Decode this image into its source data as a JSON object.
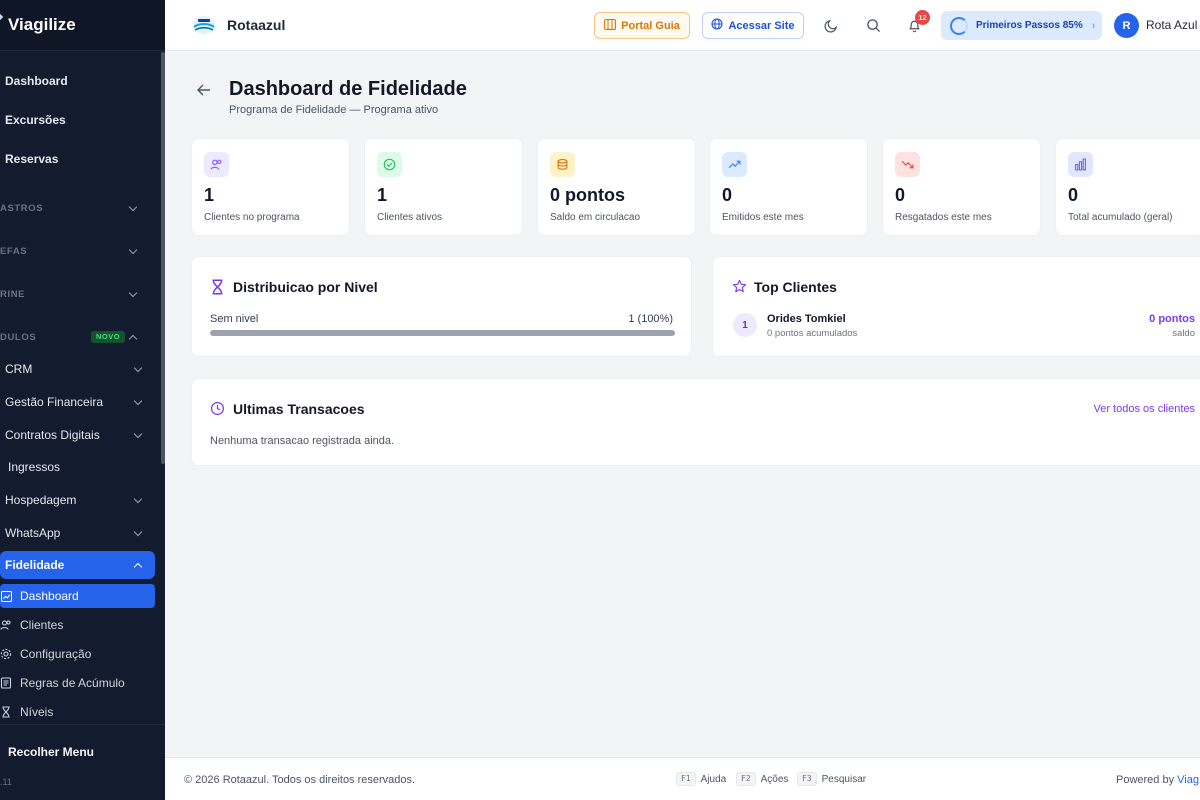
{
  "sidebar": {
    "brand": "Viagilize",
    "items": {
      "dashboard": "Dashboard",
      "excursoes": "Excursões",
      "reservas": "Reservas"
    },
    "sections": {
      "cadastros": "ASTROS",
      "tarefas": "EFAS",
      "vitrine": "RINE",
      "modulos": "DULOS"
    },
    "novo_badge": "NOVO",
    "modules": {
      "crm": "CRM",
      "financeira": "Gestão Financeira",
      "contratos": "Contratos Digitais",
      "ingressos": "Ingressos",
      "hospedagem": "Hospedagem",
      "whatsapp": "WhatsApp",
      "fidelidade": "Fidelidade"
    },
    "fidelidade_sub": {
      "dashboard": "Dashboard",
      "clientes": "Clientes",
      "configuracao": "Configuração",
      "regras": "Regras de Acúmulo",
      "niveis": "Níveis"
    },
    "collapse": "Recolher Menu",
    "version": ".11"
  },
  "header": {
    "org_name": "Rotaazul",
    "portal_guia": "Portal Guia",
    "acessar_site": "Acessar Site",
    "notifications_count": "12",
    "primeiros_passos": "Primeiros Passos 85%",
    "avatar_initial": "R",
    "user_name": "Rota Azul"
  },
  "page": {
    "title": "Dashboard de Fidelidade",
    "subtitle": "Programa de Fidelidade — Programa ativo"
  },
  "stats": [
    {
      "value": "1",
      "label": "Clientes no programa",
      "icon": "users-icon",
      "color": "#8b5cf6"
    },
    {
      "value": "1",
      "label": "Clientes ativos",
      "icon": "check-circle-icon",
      "color": "#22c55e"
    },
    {
      "value": "0 pontos",
      "label": "Saldo em circulacao",
      "icon": "coins-icon",
      "color": "#d97706"
    },
    {
      "value": "0",
      "label": "Emitidos este mes",
      "icon": "trending-up-icon",
      "color": "#3b82f6"
    },
    {
      "value": "0",
      "label": "Resgatados este mes",
      "icon": "trending-down-icon",
      "color": "#ef4444"
    },
    {
      "value": "0",
      "label": "Total acumulado (geral)",
      "icon": "bar-chart-icon",
      "color": "#6366f1"
    }
  ],
  "distribuicao": {
    "title": "Distribuicao por Nivel",
    "level_label": "Sem nivel",
    "level_value": "1 (100%)",
    "level_fraction": 1.0
  },
  "top_clientes": {
    "title": "Top Clientes",
    "rank": "1",
    "name": "Orides Tomkiel",
    "accumulated": "0 pontos acumulados",
    "points": "0 pontos",
    "points_label": "saldo"
  },
  "transacoes": {
    "title": "Ultimas Transacoes",
    "link": "Ver todos os clientes",
    "empty": "Nenhuma transacao registrada ainda."
  },
  "footer": {
    "copyright": "© 2026 Rotaazul. Todos os direitos reservados.",
    "shortcuts": [
      {
        "key": "F1",
        "label": "Ajuda"
      },
      {
        "key": "F2",
        "label": "Ações"
      },
      {
        "key": "F3",
        "label": "Pesquisar"
      }
    ],
    "powered_prefix": "Powered by ",
    "powered_brand": "Viag"
  },
  "colors": {
    "sidebar_bg": "#131b2e",
    "accent": "#2563eb",
    "points_purple": "#7c3aed"
  }
}
